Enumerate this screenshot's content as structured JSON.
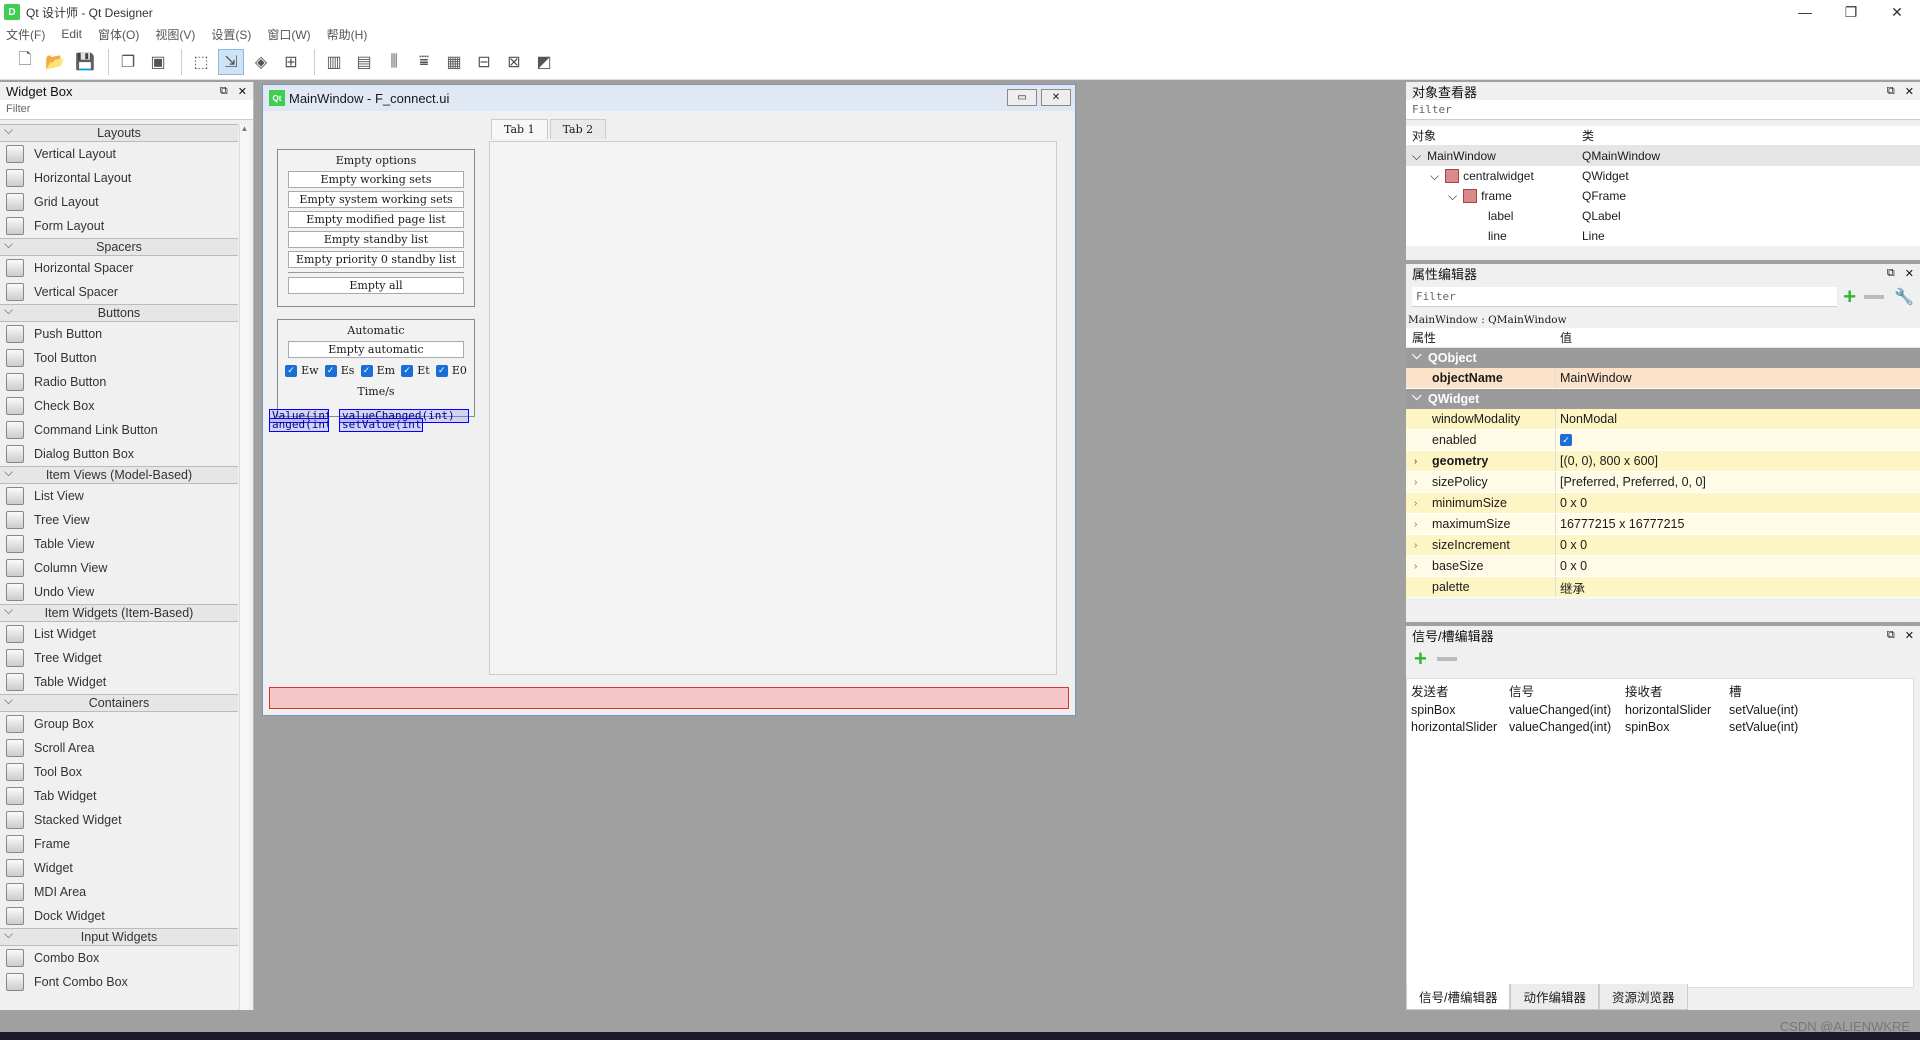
{
  "app": {
    "title": "Qt 设计师 - Qt Designer"
  },
  "menu": [
    "文件(F)",
    "Edit",
    "窗体(O)",
    "视图(V)",
    "设置(S)",
    "窗口(W)",
    "帮助(H)"
  ],
  "widgetbox": {
    "title": "Widget Box",
    "filter": "Filter",
    "categories": [
      {
        "name": "Layouts",
        "items": [
          "Vertical Layout",
          "Horizontal Layout",
          "Grid Layout",
          "Form Layout"
        ]
      },
      {
        "name": "Spacers",
        "items": [
          "Horizontal Spacer",
          "Vertical Spacer"
        ]
      },
      {
        "name": "Buttons",
        "items": [
          "Push Button",
          "Tool Button",
          "Radio Button",
          "Check Box",
          "Command Link Button",
          "Dialog Button Box"
        ]
      },
      {
        "name": "Item Views (Model-Based)",
        "items": [
          "List View",
          "Tree View",
          "Table View",
          "Column View",
          "Undo View"
        ]
      },
      {
        "name": "Item Widgets (Item-Based)",
        "items": [
          "List Widget",
          "Tree Widget",
          "Table Widget"
        ]
      },
      {
        "name": "Containers",
        "items": [
          "Group Box",
          "Scroll Area",
          "Tool Box",
          "Tab Widget",
          "Stacked Widget",
          "Frame",
          "Widget",
          "MDI Area",
          "Dock Widget"
        ]
      },
      {
        "name": "Input Widgets",
        "items": [
          "Combo Box",
          "Font Combo Box"
        ]
      }
    ]
  },
  "form": {
    "title": "MainWindow - F_connect.ui",
    "tabs": [
      "Tab 1",
      "Tab 2"
    ],
    "group1": {
      "title": "Empty options",
      "buttons": [
        "Empty working sets",
        "Empty system working sets",
        "Empty modified page list",
        "Empty standby list",
        "Empty priority 0 standby list"
      ],
      "all": "Empty all"
    },
    "group2": {
      "title": "Automatic",
      "button": "Empty automatic",
      "checks": [
        "Ew",
        "Es",
        "Em",
        "Et",
        "E0"
      ],
      "label": "Time/s"
    },
    "signals": {
      "a": "Value(int)",
      "b": "valueChanged(int)",
      "c": "anged(int)",
      "d": "setValue(int)"
    }
  },
  "objinspector": {
    "title": "对象查看器",
    "filter": "Filter",
    "headers": [
      "对象",
      "类"
    ],
    "rows": [
      {
        "name": "MainWindow",
        "cls": "QMainWindow"
      },
      {
        "name": "centralwidget",
        "cls": "QWidget"
      },
      {
        "name": "frame",
        "cls": "QFrame"
      },
      {
        "name": "label",
        "cls": "QLabel"
      },
      {
        "name": "line",
        "cls": "Line"
      }
    ]
  },
  "propeditor": {
    "title": "属性编辑器",
    "filter": "Filter",
    "context": "MainWindow : QMainWindow",
    "headers": [
      "属性",
      "值"
    ],
    "group1": "QObject",
    "objectName": {
      "name": "objectName",
      "value": "MainWindow"
    },
    "group2": "QWidget",
    "rows": [
      {
        "name": "windowModality",
        "value": "NonModal"
      },
      {
        "name": "enabled",
        "value": ""
      },
      {
        "name": "geometry",
        "value": "[(0, 0), 800 x 600]"
      },
      {
        "name": "sizePolicy",
        "value": "[Preferred, Preferred, 0, 0]"
      },
      {
        "name": "minimumSize",
        "value": "0 x 0"
      },
      {
        "name": "maximumSize",
        "value": "16777215 x 16777215"
      },
      {
        "name": "sizeIncrement",
        "value": "0 x 0"
      },
      {
        "name": "baseSize",
        "value": "0 x 0"
      },
      {
        "name": "palette",
        "value": "继承"
      }
    ]
  },
  "sigeditor": {
    "title": "信号/槽编辑器",
    "headers": [
      "发送者",
      "信号",
      "接收者",
      "槽"
    ],
    "rows": [
      [
        "spinBox",
        "valueChanged(int)",
        "horizontalSlider",
        "setValue(int)"
      ],
      [
        "horizontalSlider",
        "valueChanged(int)",
        "spinBox",
        "setValue(int)"
      ]
    ],
    "tabs": [
      "信号/槽编辑器",
      "动作编辑器",
      "资源浏览器"
    ]
  },
  "watermark": "CSDN @ALIENWKRE"
}
